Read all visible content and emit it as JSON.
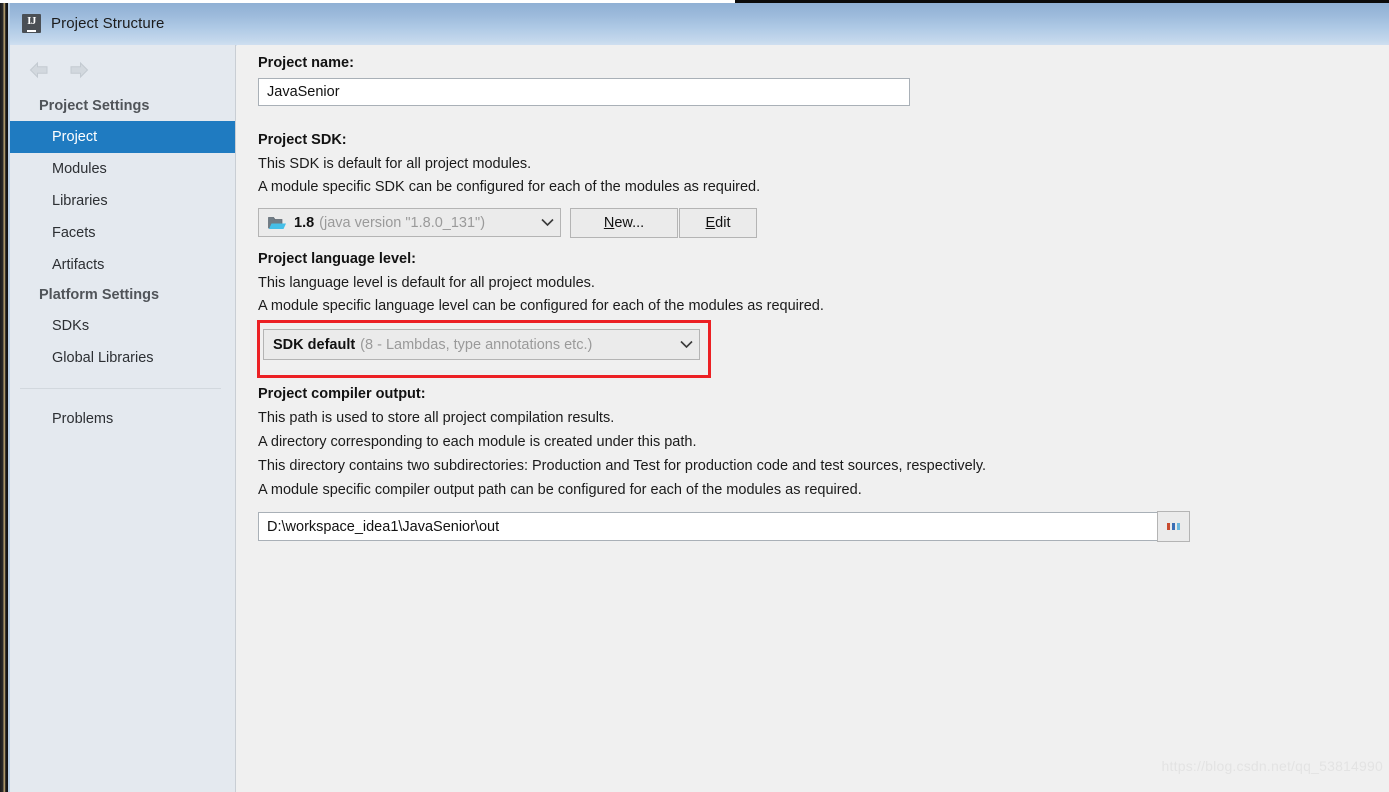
{
  "window": {
    "title": "Project Structure",
    "app_icon": "intellij-idea-icon"
  },
  "nav": {
    "back_icon": "arrow-left-icon",
    "forward_icon": "arrow-right-icon"
  },
  "sidebar": {
    "groups": [
      {
        "label": "Project Settings",
        "items": [
          {
            "label": "Project",
            "selected": true
          },
          {
            "label": "Modules",
            "selected": false
          },
          {
            "label": "Libraries",
            "selected": false
          },
          {
            "label": "Facets",
            "selected": false
          },
          {
            "label": "Artifacts",
            "selected": false
          }
        ]
      },
      {
        "label": "Platform Settings",
        "items": [
          {
            "label": "SDKs",
            "selected": false
          },
          {
            "label": "Global Libraries",
            "selected": false
          }
        ]
      }
    ],
    "footer_items": [
      {
        "label": "Problems",
        "selected": false
      }
    ]
  },
  "main": {
    "project_name": {
      "label": "Project name:",
      "value": "JavaSenior"
    },
    "project_sdk": {
      "label": "Project SDK:",
      "desc_lines": [
        "This SDK is default for all project modules.",
        "A module specific SDK can be configured for each of the modules as required."
      ],
      "combo_bold": "1.8",
      "combo_gray": "(java version \"1.8.0_131\")",
      "combo_icon": "sdk-folder-icon",
      "chevron_icon": "chevron-down-icon",
      "new_button": {
        "mnemonic": "N",
        "rest": "ew..."
      },
      "edit_button": {
        "mnemonic": "E",
        "rest": "dit"
      }
    },
    "language_level": {
      "label": "Project language level:",
      "desc_lines": [
        "This language level is default for all project modules.",
        "A module specific language level can be configured for each of the modules as required."
      ],
      "combo_bold": "SDK default",
      "combo_gray": "(8 - Lambdas, type annotations etc.)",
      "chevron_icon": "chevron-down-icon"
    },
    "compiler_output": {
      "label": "Project compiler output:",
      "desc_lines": [
        "This path is used to store all project compilation results.",
        "A directory corresponding to each module is created under this path.",
        "This directory contains two subdirectories: Production and Test for production code and test sources, respectively.",
        "A module specific compiler output path can be configured for each of the modules as required."
      ],
      "value": "D:\\workspace_idea1\\JavaSenior\\out",
      "browse_button_icon": "ellipsis-icon"
    }
  },
  "annotation": {
    "highlight_color": "#ec2024",
    "target": "language-level-combo"
  },
  "watermark": {
    "text": "https://blog.csdn.net/qq_53814990"
  },
  "colors": {
    "selection_blue": "#1f7bc1",
    "titlebar_top": "#8fb0d4",
    "titlebar_bottom": "#cfdff0",
    "sidebar_bg": "#e4e9ef",
    "panel_bg": "#f0f0f0"
  }
}
